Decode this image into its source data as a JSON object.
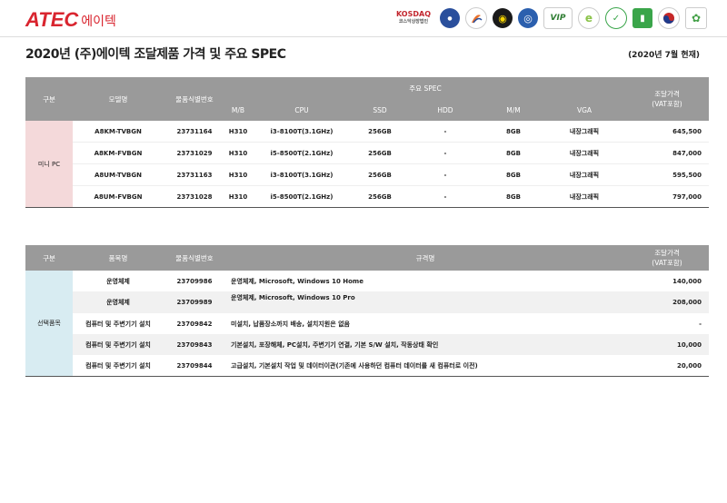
{
  "header": {
    "logo_text": "ATEC",
    "logo_korean": "에이텍",
    "cert_kosdaq": "KOSDAQ",
    "cert_kosdaq_sub": "코스닥상장법인",
    "cert_icons": [
      "emblem-icon",
      "seal-icon",
      "circle-logo-icon",
      "globe-icon",
      "vip-logo-icon",
      "eco-icon",
      "green-badge-icon",
      "leaf-box-icon",
      "taegeuk-icon",
      "plant-icon"
    ]
  },
  "title": "2020년 (주)에이텍 조달제품 가격 및 주요 SPEC",
  "date_note": "(2020년 7월  현재)",
  "table1": {
    "headers": {
      "category": "구분",
      "model": "모델명",
      "id": "물품식별번호",
      "spec": "주요 SPEC",
      "price": "조달가격\n(VAT포함)",
      "mb": "M/B",
      "cpu": "CPU",
      "ssd": "SSD",
      "hdd": "HDD",
      "mm": "M/M",
      "vga": "VGA"
    },
    "group": "미니 PC",
    "rows": [
      {
        "model": "A8KM-TVBGN",
        "id": "23731164",
        "mb": "H310",
        "cpu": "i3-8100T(3.1GHz)",
        "ssd": "256GB",
        "hdd": "-",
        "mm": "8GB",
        "vga": "내장그래픽",
        "price": "645,500"
      },
      {
        "model": "A8KM-FVBGN",
        "id": "23731029",
        "mb": "H310",
        "cpu": "i5-8500T(2.1GHz)",
        "ssd": "256GB",
        "hdd": "-",
        "mm": "8GB",
        "vga": "내장그래픽",
        "price": "847,000"
      },
      {
        "model": "A8UM-TVBGN",
        "id": "23731163",
        "mb": "H310",
        "cpu": "i3-8100T(3.1GHz)",
        "ssd": "256GB",
        "hdd": "-",
        "mm": "8GB",
        "vga": "내장그래픽",
        "price": "595,500"
      },
      {
        "model": "A8UM-FVBGN",
        "id": "23731028",
        "mb": "H310",
        "cpu": "i5-8500T(2.1GHz)",
        "ssd": "256GB",
        "hdd": "-",
        "mm": "8GB",
        "vga": "내장그래픽",
        "price": "797,000"
      }
    ]
  },
  "table2": {
    "headers": {
      "category": "구분",
      "item": "품목명",
      "id": "물품식별번호",
      "spec": "규격명",
      "price": "조달가격\n(VAT포함)"
    },
    "group": "선택품목",
    "rows": [
      {
        "item": "운영체제",
        "id": "23709986",
        "spec": "운영체제, Microsoft, Windows 10 Home",
        "price": "140,000"
      },
      {
        "item": "운영체제",
        "id": "23709989",
        "spec": "운영체제, Microsoft, Windows 10 Pro",
        "price": "208,000"
      },
      {
        "item": "컴퓨터 및 주변기기 설치",
        "id": "23709842",
        "spec": "미설치, 납품장소까지 배송, 설치지원은 없음",
        "price": "-"
      },
      {
        "item": "컴퓨터 및 주변기기 설치",
        "id": "23709843",
        "spec": "기본설치, 포장해체, PC설치, 주변기기 연결, 기본 S/W 설치, 작동상태 확인",
        "price": "10,000"
      },
      {
        "item": "컴퓨터 및 주변기기 설치",
        "id": "23709844",
        "spec": "고급설치, 기본설치 작업 및 데이터이관(기존에 사용하던 컴퓨터 데이터를 새 컴퓨터로 이전)",
        "price": "20,000"
      }
    ]
  }
}
